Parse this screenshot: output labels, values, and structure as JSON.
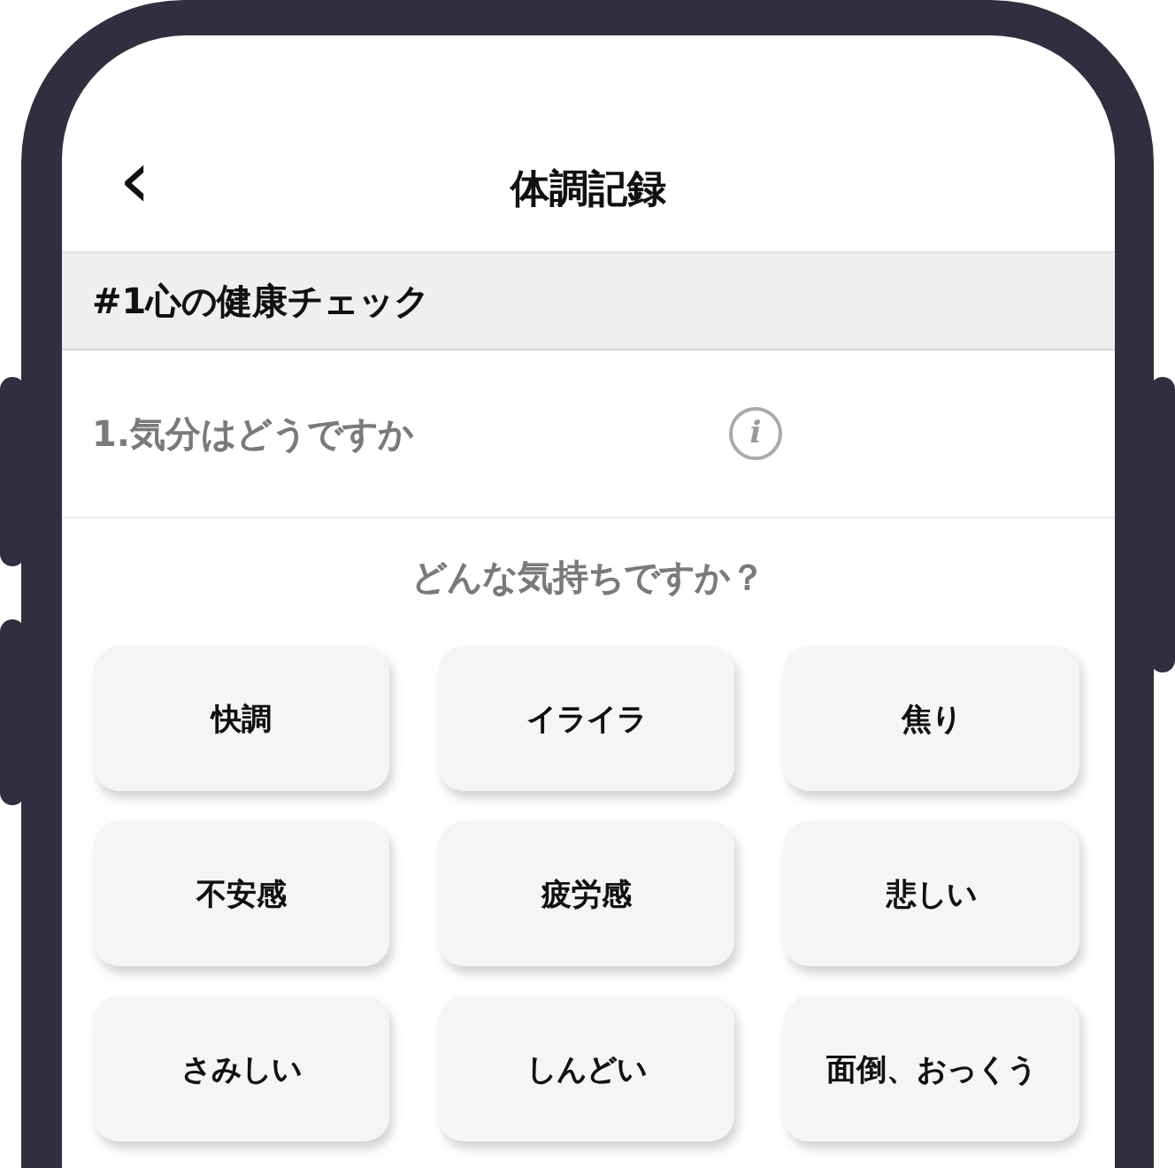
{
  "header": {
    "back": "‹",
    "title": "体調記録"
  },
  "section": {
    "title": "#1心の健康チェック"
  },
  "question": {
    "label": "1.気分はどうですか",
    "info": "i"
  },
  "prompt": "どんな気持ちですか？",
  "options": [
    {
      "label": "快調",
      "selected": false
    },
    {
      "label": "イライラ",
      "selected": false
    },
    {
      "label": "焦り",
      "selected": false
    },
    {
      "label": "不安感",
      "selected": false
    },
    {
      "label": "疲労感",
      "selected": false
    },
    {
      "label": "悲しい",
      "selected": false
    },
    {
      "label": "さみしい",
      "selected": false
    },
    {
      "label": "しんどい",
      "selected": false
    },
    {
      "label": "面倒、おっくう",
      "selected": false
    }
  ]
}
